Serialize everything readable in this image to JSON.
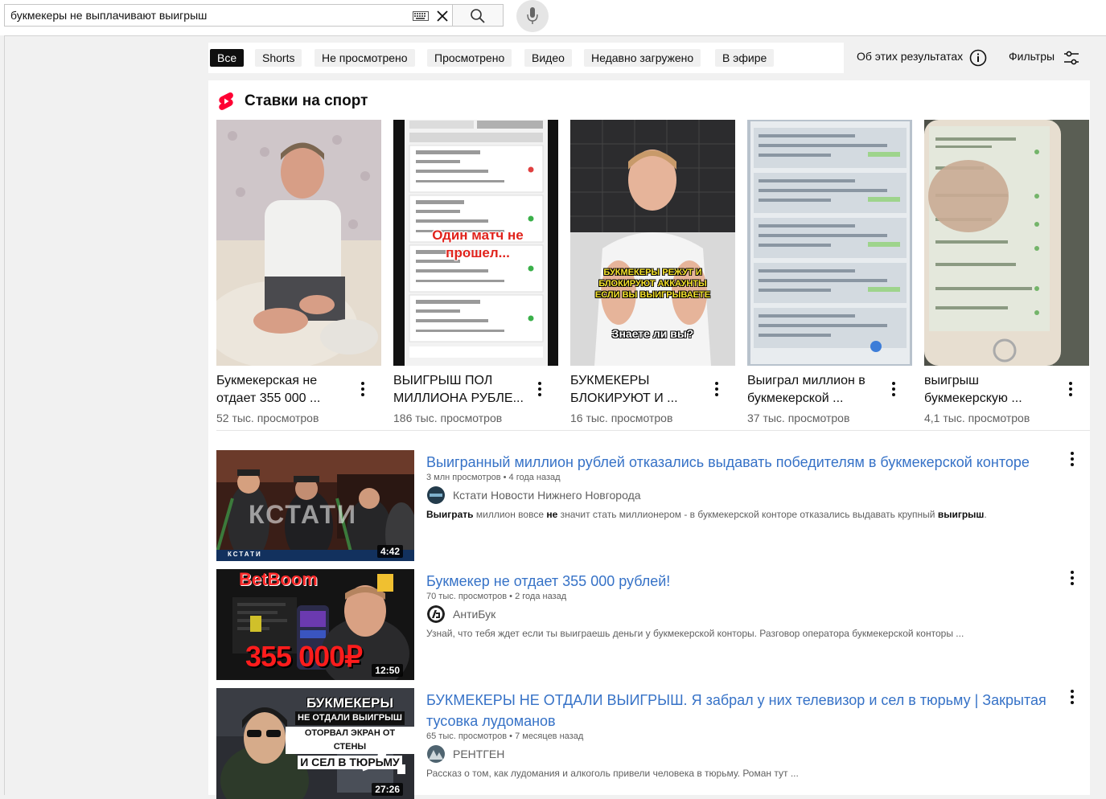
{
  "search": {
    "query": "букмекеры не выплачивают выигрыш"
  },
  "chips": [
    {
      "label": "Все",
      "active": true
    },
    {
      "label": "Shorts"
    },
    {
      "label": "Не просмотрено"
    },
    {
      "label": "Просмотрено"
    },
    {
      "label": "Видео"
    },
    {
      "label": "Недавно загружено"
    },
    {
      "label": "В эфире"
    }
  ],
  "about_results": "Об этих результатах",
  "filters": "Фильтры",
  "shorts_shelf": {
    "title": "Ставки на спорт",
    "items": [
      {
        "title_1": "Букмекерская не",
        "title_2": "отдает 355 000 ...",
        "views": "52 тыс. просмотров"
      },
      {
        "title_1": "ВЫИГРЫШ ПОЛ",
        "title_2": "МИЛЛИОНА РУБЛЕ...",
        "views": "186 тыс. просмотров",
        "overlay_1": "Один матч не",
        "overlay_2": "прошел..."
      },
      {
        "title_1": "БУКМЕКЕРЫ",
        "title_2": "БЛОКИРУЮТ И ...",
        "views": "16 тыс. просмотров",
        "overlay_1": "БУКМЕКЕРЫ РЕЖУТ И",
        "overlay_2": "БЛОКИРУЮТ АККАУНТЫ",
        "overlay_3": "ЕСЛИ ВЫ ВЫИГРЫВАЕТЕ",
        "overlay_4": "Знаете ли вы?"
      },
      {
        "title_1": "Выиграл миллион в",
        "title_2": "букмекерской ...",
        "views": "37 тыс. просмотров"
      },
      {
        "title_1": "выигрыш",
        "title_2": "букмекерскую ...",
        "views": "4,1 тыс. просмотров"
      }
    ]
  },
  "videos": [
    {
      "title": "Выигранный миллион рублей отказались выдавать победителям в букмекерской конторе",
      "views": "3 млн просмотров",
      "age": "4 года назад",
      "channel": "Кстати Новости Нижнего Новгорода",
      "desc_1": "Выиграть",
      "desc_2": " миллион вовсе ",
      "desc_3": "не",
      "desc_4": " значит стать миллионером - в букмекерской конторе отказались выдавать крупный ",
      "desc_5": "выигрыш",
      "desc_6": ".",
      "duration": "4:42",
      "thumb_text": "КСТАТИ",
      "ticker": "КСТАТИ"
    },
    {
      "title": "Букмекер не отдает 355 000 рублей!",
      "views": "70 тыс. просмотров",
      "age": "2 года назад",
      "channel": "АнтиБук",
      "desc": "Узнай, что тебя ждет если ты выиграешь деньги у букмекерской конторы. Разговор оператора букмекерской конторы ...",
      "duration": "12:50",
      "brand": "BetBoom",
      "amount": "355 000₽"
    },
    {
      "title_1": "БУКМЕКЕРЫ НЕ ОТДАЛИ ВЫИГРЫШ. Я забрал у них телевизор и сел в тюрьму | Закрытая",
      "title_2": "тусовка лудоманов",
      "views": "65 тыс. просмотров",
      "age": "7 месяцев назад",
      "channel": "РЕНТГЕН",
      "desc": "Рассказ о том, как лудомания и алкоголь привели человека в тюрьму. Роман тут ...",
      "duration": "27:26",
      "thumb_1": "БУКМЕКЕРЫ",
      "thumb_2": "НЕ ОТДАЛИ ВЫИГРЫШ",
      "thumb_3": "ОТОРВАЛ ЭКРАН ОТ СТЕНЫ",
      "thumb_4": "И СЕЛ В ТЮРЬМУ"
    }
  ],
  "colors": {
    "link_blue": "#3672c7",
    "shorts_red": "#ff0033",
    "chip_active": "#0f0f0f",
    "chip_bg": "#f0f0f0"
  }
}
